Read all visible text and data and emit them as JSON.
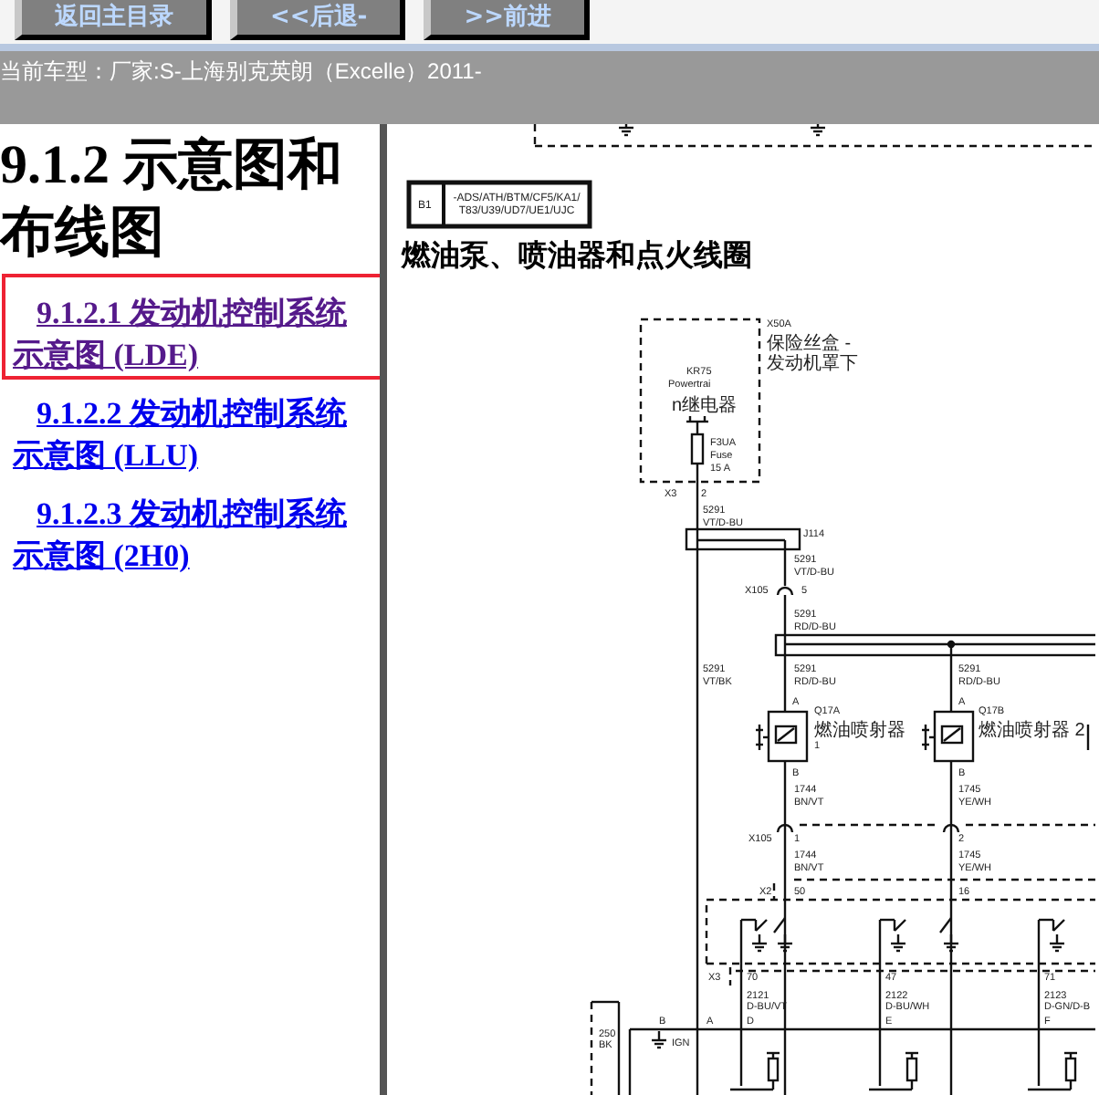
{
  "toolbar": {
    "buttons": [
      "返回主目录",
      "<<后退-",
      ">>前进"
    ]
  },
  "model_bar": {
    "text": "当前车型：厂家:S-上海别克英朗（Excelle）2011-"
  },
  "sidebar": {
    "heading": "9.1.2 示意图和布线图",
    "links": [
      {
        "text": "9.1.2.1 发动机控制系统示意图 (LDE)",
        "visited": true,
        "highlighted": true
      },
      {
        "text": "9.1.2.2 发动机控制系统示意图 (LLU)",
        "visited": false,
        "highlighted": false
      },
      {
        "text": "9.1.2.3 发动机控制系统示意图 (2H0)",
        "visited": false,
        "highlighted": false
      }
    ]
  },
  "diagram": {
    "option_box": {
      "code": "B1",
      "options": [
        "-ADS/ATH/BTM/CF5/KA1/",
        "T83/U39/UD7/UE1/UJC"
      ]
    },
    "title": "燃油泵、喷油器和点火线圈",
    "labels": [
      "X50A",
      "保险丝盒 -",
      "发动机罩下",
      "KR75",
      "Powertrai",
      "n继电器",
      "F3UA",
      "Fuse",
      "15 A",
      "X3",
      "2",
      "5291",
      "VT/D-BU",
      "J114",
      "5291",
      "VT/D-BU",
      "X105",
      "5",
      "5291",
      "RD/D-BU",
      "5291",
      "VT/BK",
      "5291",
      "RD/D-BU",
      "5291",
      "RD/D-BU",
      "A",
      "Q17A",
      "燃油喷射器",
      "1",
      "A",
      "Q17B",
      "燃油喷射器 2",
      "B",
      "1744",
      "BN/VT",
      "B",
      "1745",
      "YE/WH",
      "X105",
      "1",
      "2",
      "1744",
      "BN/VT",
      "1745",
      "YE/WH",
      "X2",
      "50",
      "16",
      "X3",
      "70",
      "47",
      "71",
      "2121",
      "D-BU/VT",
      "2122",
      "D-BU/WH",
      "2123",
      "D-GN/D-B",
      "B",
      "A",
      "D",
      "E",
      "F",
      "IGN",
      "250",
      "BK"
    ]
  }
}
